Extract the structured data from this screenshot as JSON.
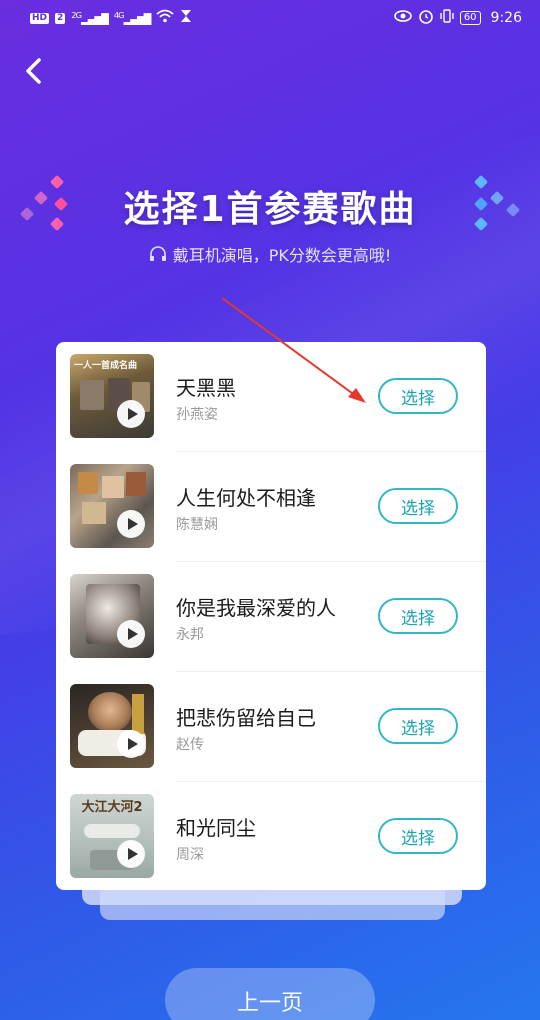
{
  "status_bar": {
    "hd_label": "HD",
    "sim_label": "2",
    "signal_1": "2G",
    "signal_2": "4G",
    "battery": "60",
    "time": "9:26"
  },
  "header": {
    "back_icon": "chevron-left-icon",
    "title": "选择1首参赛歌曲",
    "subtitle": "戴耳机演唱，PK分数会更高哦!",
    "subtitle_icon": "headphones-icon"
  },
  "songs": [
    {
      "title": "天黑黑",
      "artist": "孙燕姿",
      "button": "选择"
    },
    {
      "title": "人生何处不相逢",
      "artist": "陈慧娴",
      "button": "选择"
    },
    {
      "title": "你是我最深爱的人",
      "artist": "永邦",
      "button": "选择"
    },
    {
      "title": "把悲伤留给自己",
      "artist": "赵传",
      "button": "选择"
    },
    {
      "title": "和光同尘",
      "artist": "周深",
      "button": "选择"
    }
  ],
  "album_text": {
    "cover1": "一人一首成名曲",
    "cover5": "大江大河2"
  },
  "footer": {
    "prev_label": "上一页"
  },
  "colors": {
    "accent": "#1aa3b6",
    "annotation": "#e23a2e"
  }
}
